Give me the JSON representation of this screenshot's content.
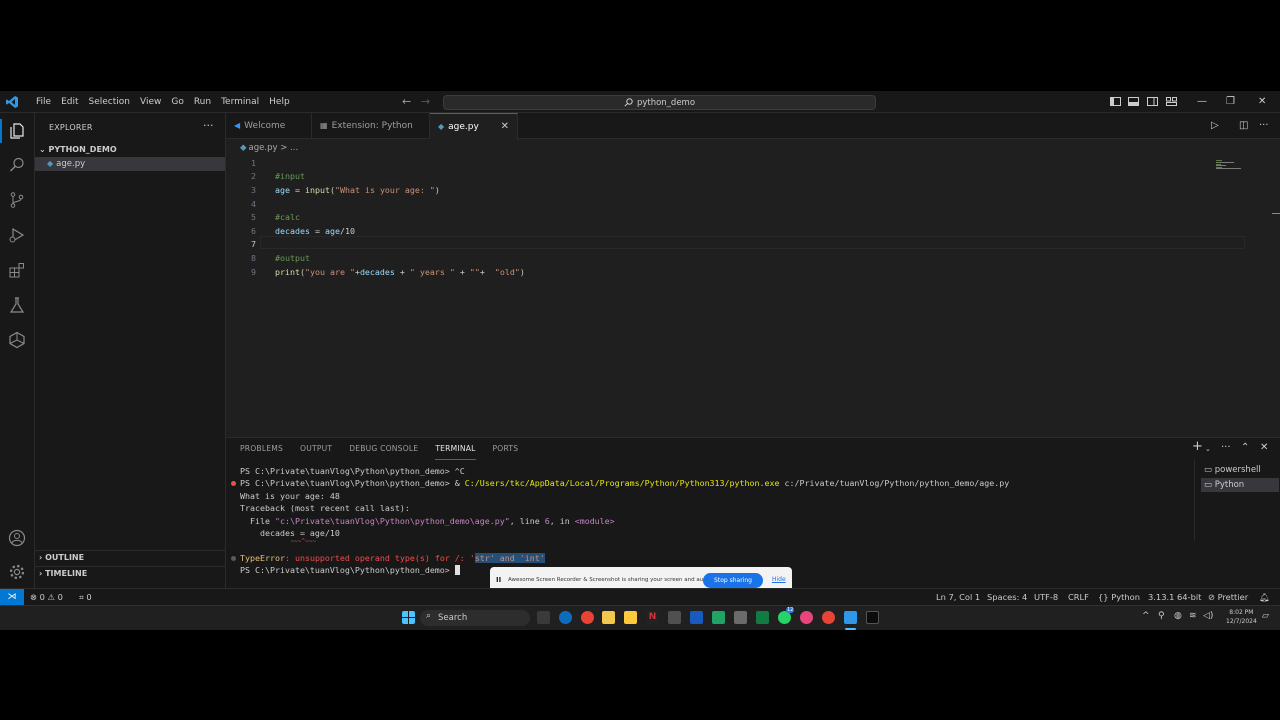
{
  "menu": [
    "File",
    "Edit",
    "Selection",
    "View",
    "Go",
    "Run",
    "Terminal",
    "Help"
  ],
  "command_center": {
    "label": "python_demo"
  },
  "sidebar": {
    "title": "EXPLORER",
    "folder": "PYTHON_DEMO",
    "file": "age.py",
    "outline": "OUTLINE",
    "timeline": "TIMELINE"
  },
  "tabs": [
    {
      "label": "Welcome"
    },
    {
      "label": "Extension: Python"
    },
    {
      "label": "age.py"
    }
  ],
  "breadcrumb": {
    "file": "age.py",
    "rest": "> ..."
  },
  "editor": {
    "line_numbers": [
      "1",
      "2",
      "3",
      "4",
      "5",
      "6",
      "7",
      "8",
      "9"
    ],
    "lines": [
      "",
      "#input",
      "age = input(\"What is your age: \")",
      "",
      "#calc",
      "decades = age/10",
      "",
      "#output",
      "print(\"you are \"+decades + \" years \" + \"\"+  \"old\")"
    ]
  },
  "panel": {
    "tabs": [
      "PROBLEMS",
      "OUTPUT",
      "DEBUG CONSOLE",
      "TERMINAL",
      "PORTS"
    ],
    "active_tab": "TERMINAL",
    "terminals": [
      "powershell",
      "Python"
    ],
    "lines": {
      "l1_prompt": "PS C:\\Private\\tuanVlog\\Python\\python_demo> ",
      "l1_rest": "^C",
      "l2_prompt": "PS C:\\Private\\tuanVlog\\Python\\python_demo> ",
      "l2_amp": "& ",
      "l2_exe": "C:/Users/tkc/AppData/Local/Programs/Python/Python313/python.exe",
      "l2_arg": " c:/Private/tuanVlog/Python/python_demo/age.py",
      "l3": "What is your age: 48",
      "l4": "Traceback (most recent call last):",
      "l5_a": "  File ",
      "l5_file": "\"c:\\Private\\tuanVlog\\Python\\python_demo\\age.py\"",
      "l5_b": ", line ",
      "l5_line": "6",
      "l5_c": ", in ",
      "l5_mod": "<module>",
      "l6": "    decades = age/10",
      "l7": "              ~~~^~~~",
      "l8_a": "TypeError",
      "l8_b": ": unsupported operand type(s) for /: '",
      "l8_sel": "str' and 'int'",
      "l9_prompt": "PS C:\\Private\\tuanVlog\\Python\\python_demo> "
    }
  },
  "status": {
    "errors": "0",
    "warnings": "0",
    "ports": "0",
    "position": "Ln 7, Col 1",
    "spaces": "Spaces: 4",
    "encoding": "UTF-8",
    "eol": "CRLF",
    "language": "Python",
    "interpreter": "3.13.1 64-bit",
    "prettier": "Prettier"
  },
  "share_banner": {
    "message": "Awesome Screen Recorder & Screenshot is sharing your screen and audio.",
    "stop": "Stop sharing",
    "hide": "Hide"
  },
  "taskbar": {
    "search": "Search",
    "time": "8:02 PM",
    "date": "12/7/2024",
    "badge": "12"
  },
  "colors": {
    "accent": "#0078d4",
    "editor_bg": "#1f1f1f",
    "chrome_bg": "#181818",
    "error": "#f14c4c"
  }
}
